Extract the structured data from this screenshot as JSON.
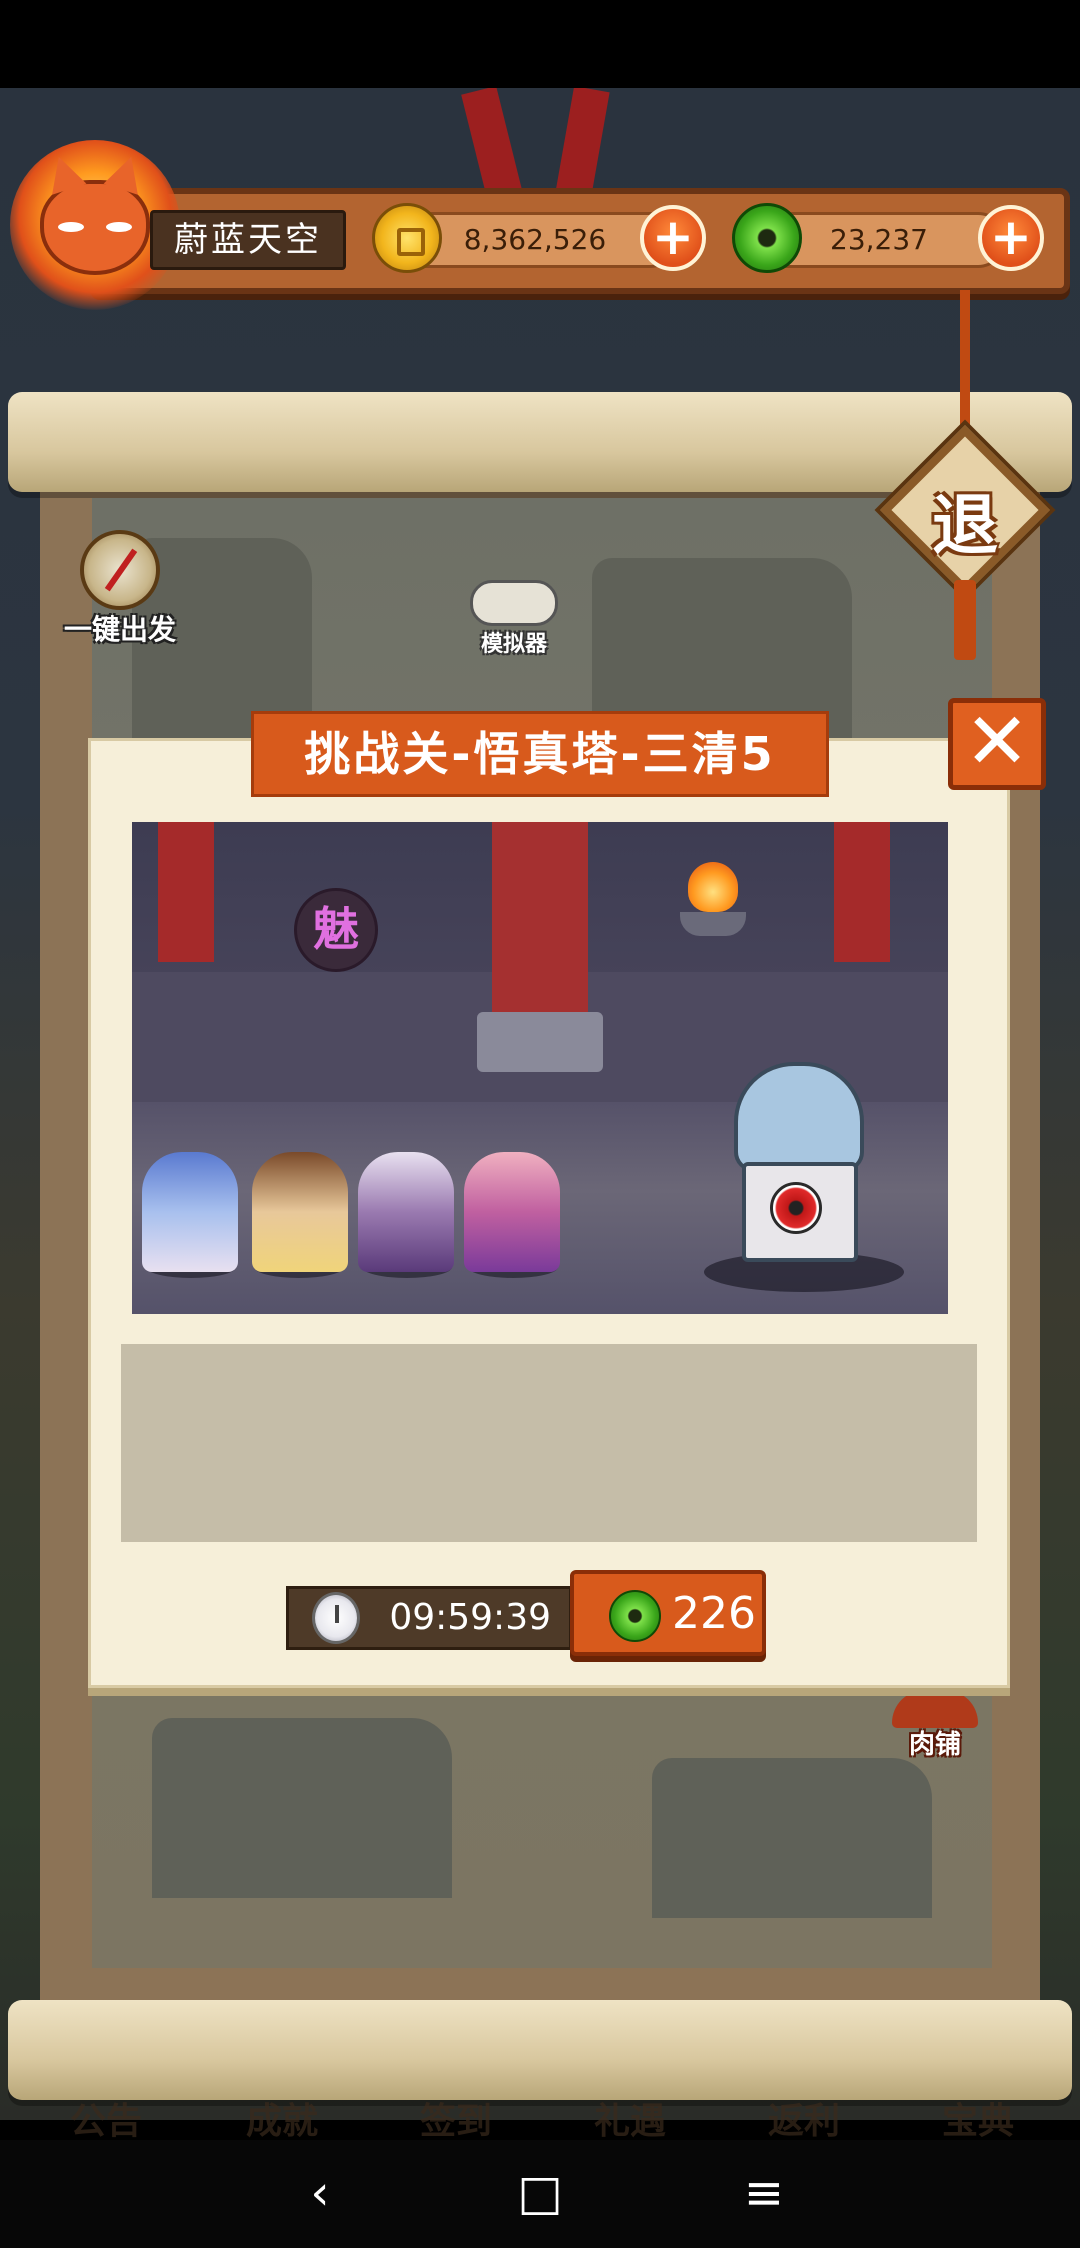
{
  "player": {
    "name": "蔚蓝天空",
    "avatar_icon": "fox-mask-icon"
  },
  "resources": {
    "gold": {
      "value": "8,362,526",
      "icon": "gold-coin-icon"
    },
    "jade": {
      "value": "23,237",
      "icon": "green-jade-coin-icon"
    },
    "add_symbol": "+"
  },
  "map": {
    "one_click_label": "一键出发",
    "emulator_label": "模拟器",
    "exit_label": "退",
    "butcher_label": "肉铺"
  },
  "modal": {
    "title": "挑战关-悟真塔-三清5",
    "close_symbol": "✕",
    "charm_badge": "魅",
    "timer": "09:59:39",
    "cost": "226"
  },
  "bottom_menu": [
    "公告",
    "成就",
    "签到",
    "礼遇",
    "返利",
    "宝典"
  ],
  "nav": {
    "back": "‹",
    "home": "□",
    "menu": "≡"
  },
  "colors": {
    "accent": "#d85a1c",
    "panel": "#f6efd9",
    "jade": "#3aa61a",
    "gold": "#f2b51c"
  }
}
